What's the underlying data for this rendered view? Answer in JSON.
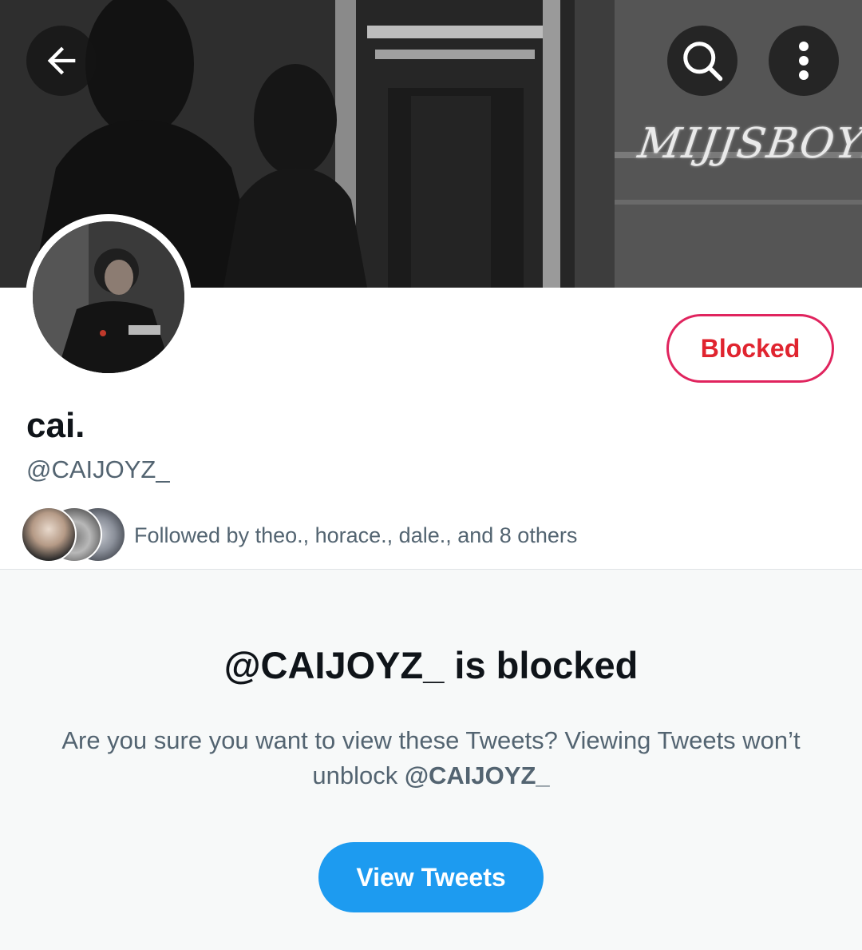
{
  "header": {
    "back_icon": "arrow-left-icon",
    "search_icon": "search-icon",
    "more_icon": "more-vertical-icon",
    "brand_mark": "MIJJSBOYZ"
  },
  "profile": {
    "display_name": "cai.",
    "handle": "@CAIJOYZ_",
    "blocked_label": "Blocked",
    "followed_by": "Followed by theo., horace., dale., and 8 others"
  },
  "blocked_notice": {
    "title": "@CAIJOYZ_ is blocked",
    "description": "Are you sure you want to view these Tweets? Viewing Tweets won’t unblock ",
    "handle": "@CAIJOYZ_",
    "button_label": "View Tweets"
  },
  "colors": {
    "accent": "#1d9bf0",
    "blocked_red": "#e0245e",
    "text_primary": "#0f1419",
    "text_secondary": "#536471"
  }
}
